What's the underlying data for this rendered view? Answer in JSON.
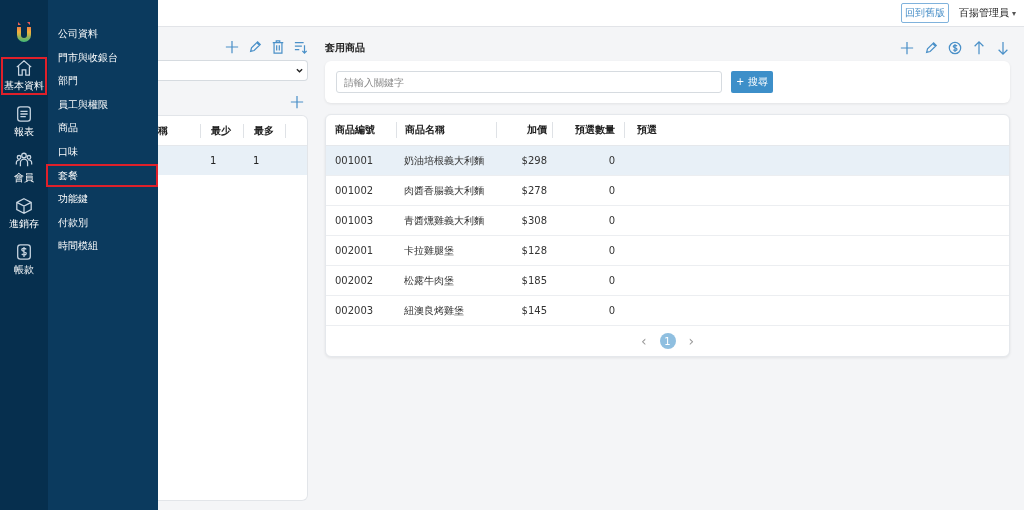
{
  "rail": {
    "items": [
      {
        "label": "基本資料",
        "selected": true
      },
      {
        "label": "報表",
        "selected": false
      },
      {
        "label": "會員",
        "selected": false
      },
      {
        "label": "進銷存",
        "selected": false
      },
      {
        "label": "帳款",
        "selected": false
      }
    ]
  },
  "submenu": {
    "items": [
      {
        "label": "公司資料",
        "selected": false
      },
      {
        "label": "門市與收銀台",
        "selected": false
      },
      {
        "label": "部門",
        "selected": false
      },
      {
        "label": "員工與權限",
        "selected": false
      },
      {
        "label": "商品",
        "selected": false
      },
      {
        "label": "口味",
        "selected": false
      },
      {
        "label": "套餐",
        "selected": true
      },
      {
        "label": "功能鍵",
        "selected": false
      },
      {
        "label": "付款別",
        "selected": false
      },
      {
        "label": "時間模組",
        "selected": false
      }
    ]
  },
  "topbar": {
    "old_version_button": "回到舊版",
    "user": "百揚管理員",
    "caret": "▾"
  },
  "left_panel": {
    "table": {
      "columns": [
        "稱",
        "最少",
        "最多"
      ],
      "rows": [
        {
          "cells": [
            "",
            "1",
            "1"
          ],
          "selected": true
        }
      ]
    }
  },
  "main": {
    "title": "套用商品",
    "search": {
      "placeholder": "請輸入關鍵字",
      "button": "+ 搜尋"
    },
    "table": {
      "columns": [
        "商品編號",
        "商品名稱",
        "加價",
        "預選數量",
        "預選"
      ],
      "rows": [
        {
          "cells": [
            "001001",
            "奶油培根義大利麵",
            "$298",
            "0"
          ],
          "selected": true
        },
        {
          "cells": [
            "001002",
            "肉醬香腸義大利麵",
            "$278",
            "0"
          ],
          "selected": false
        },
        {
          "cells": [
            "001003",
            "青醬燻雞義大利麵",
            "$308",
            "0"
          ],
          "selected": false
        },
        {
          "cells": [
            "002001",
            "卡拉雞腿堡",
            "$128",
            "0"
          ],
          "selected": false
        },
        {
          "cells": [
            "002002",
            "松露牛肉堡",
            "$185",
            "0"
          ],
          "selected": false
        },
        {
          "cells": [
            "002003",
            "紐澳良烤雞堡",
            "$145",
            "0"
          ],
          "selected": false
        }
      ]
    },
    "pagination": {
      "prev": "‹",
      "pages": [
        {
          "label": "1",
          "selected": true
        }
      ],
      "next": "›"
    }
  }
}
